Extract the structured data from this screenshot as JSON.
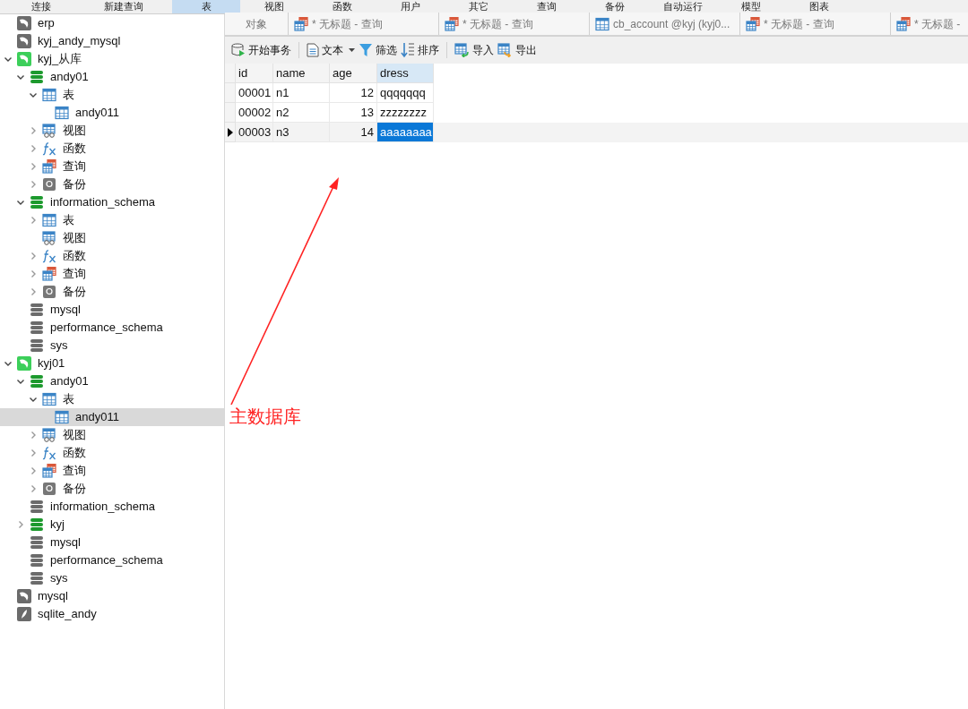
{
  "menu": [
    {
      "label": "连接",
      "selected": false
    },
    {
      "label": "新建查询",
      "selected": false
    },
    {
      "label": "表",
      "selected": true
    },
    {
      "label": "视图",
      "selected": false
    },
    {
      "label": "函数",
      "selected": false
    },
    {
      "label": "用户",
      "selected": false
    },
    {
      "label": "其它",
      "selected": false
    },
    {
      "label": "查询",
      "selected": false
    },
    {
      "label": "备份",
      "selected": false
    },
    {
      "label": "自动运行",
      "selected": false
    },
    {
      "label": "模型",
      "selected": false
    },
    {
      "label": "图表",
      "selected": false
    }
  ],
  "tree": [
    {
      "label": "erp",
      "kind": "connection",
      "active": false
    },
    {
      "label": "kyj_andy_mysql",
      "kind": "connection",
      "active": false
    },
    {
      "label": "kyj_从库",
      "kind": "connection",
      "active": true,
      "expanded": true,
      "children": [
        {
          "label": "andy01",
          "kind": "database",
          "active": true,
          "expanded": true,
          "children": [
            {
              "label": "表",
              "kind": "tables",
              "expanded": true,
              "children": [
                {
                  "label": "andy011",
                  "kind": "table",
                  "selected": false
                }
              ]
            },
            {
              "label": "视图",
              "kind": "views",
              "expanded": false
            },
            {
              "label": "函数",
              "kind": "functions",
              "expanded": false
            },
            {
              "label": "查询",
              "kind": "queries",
              "expanded": false
            },
            {
              "label": "备份",
              "kind": "backups",
              "expanded": false
            }
          ]
        },
        {
          "label": "information_schema",
          "kind": "database",
          "active": true,
          "expanded": true,
          "children": [
            {
              "label": "表",
              "kind": "tables",
              "expanded": false
            },
            {
              "label": "视图",
              "kind": "views"
            },
            {
              "label": "函数",
              "kind": "functions",
              "expanded": false
            },
            {
              "label": "查询",
              "kind": "queries",
              "expanded": false
            },
            {
              "label": "备份",
              "kind": "backups",
              "expanded": false
            }
          ]
        },
        {
          "label": "mysql",
          "kind": "database",
          "active": false
        },
        {
          "label": "performance_schema",
          "kind": "database",
          "active": false
        },
        {
          "label": "sys",
          "kind": "database",
          "active": false
        }
      ]
    },
    {
      "label": "kyj01",
      "kind": "connection",
      "active": true,
      "expanded": true,
      "children": [
        {
          "label": "andy01",
          "kind": "database",
          "active": true,
          "expanded": true,
          "children": [
            {
              "label": "表",
              "kind": "tables",
              "expanded": true,
              "children": [
                {
                  "label": "andy011",
                  "kind": "table",
                  "selected": true
                }
              ]
            },
            {
              "label": "视图",
              "kind": "views",
              "expanded": false
            },
            {
              "label": "函数",
              "kind": "functions",
              "expanded": false
            },
            {
              "label": "查询",
              "kind": "queries",
              "expanded": false
            },
            {
              "label": "备份",
              "kind": "backups",
              "expanded": false
            }
          ]
        },
        {
          "label": "information_schema",
          "kind": "database",
          "active": false
        },
        {
          "label": "kyj",
          "kind": "database",
          "active": true,
          "expanded": false
        },
        {
          "label": "mysql",
          "kind": "database",
          "active": false
        },
        {
          "label": "performance_schema",
          "kind": "database",
          "active": false
        },
        {
          "label": "sys",
          "kind": "database",
          "active": false
        }
      ]
    },
    {
      "label": "mysql",
      "kind": "connection",
      "active": false
    },
    {
      "label": "sqlite_andy",
      "kind": "sqlite",
      "active": false
    }
  ],
  "tabs": [
    {
      "label": "对象",
      "kind": "objects",
      "selected": false
    },
    {
      "label": "* 无标题 - 查询",
      "kind": "query",
      "selected": false
    },
    {
      "label": "* 无标题 - 查询",
      "kind": "query",
      "selected": false
    },
    {
      "label": "cb_account @kyj (kyj0...",
      "kind": "table",
      "selected": false
    },
    {
      "label": "* 无标题 - 查询",
      "kind": "query",
      "selected": false
    },
    {
      "label": "* 无标题 -",
      "kind": "query",
      "selected": false
    }
  ],
  "toolbar": [
    {
      "label": "开始事务",
      "kind": "transaction"
    },
    {
      "label": "文本",
      "kind": "text"
    },
    {
      "label": "筛选",
      "kind": "filter"
    },
    {
      "label": "排序",
      "kind": "sort"
    },
    {
      "label": "导入",
      "kind": "import"
    },
    {
      "label": "导出",
      "kind": "export"
    }
  ],
  "grid": {
    "columns": [
      {
        "label": "id",
        "kind": "text",
        "selected": false
      },
      {
        "label": "name",
        "kind": "text",
        "selected": false
      },
      {
        "label": "age",
        "kind": "number",
        "selected": false
      },
      {
        "label": "dress",
        "kind": "text",
        "selected": true
      }
    ],
    "rows": [
      {
        "current": false,
        "cells": [
          {
            "text": "00001",
            "selected": false
          },
          {
            "text": "n1",
            "selected": false
          },
          {
            "text": "12",
            "selected": false
          },
          {
            "text": "qqqqqqq",
            "selected": false
          }
        ]
      },
      {
        "current": false,
        "cells": [
          {
            "text": "00002",
            "selected": false
          },
          {
            "text": "n2",
            "selected": false
          },
          {
            "text": "13",
            "selected": false
          },
          {
            "text": "zzzzzzzz",
            "selected": false
          }
        ]
      },
      {
        "current": true,
        "cells": [
          {
            "text": "00003",
            "selected": false
          },
          {
            "text": "n3",
            "selected": false
          },
          {
            "text": "14",
            "selected": false
          },
          {
            "text": "aaaaaaaa",
            "selected": true
          }
        ]
      }
    ]
  },
  "annotation": {
    "text": "主数据库"
  }
}
